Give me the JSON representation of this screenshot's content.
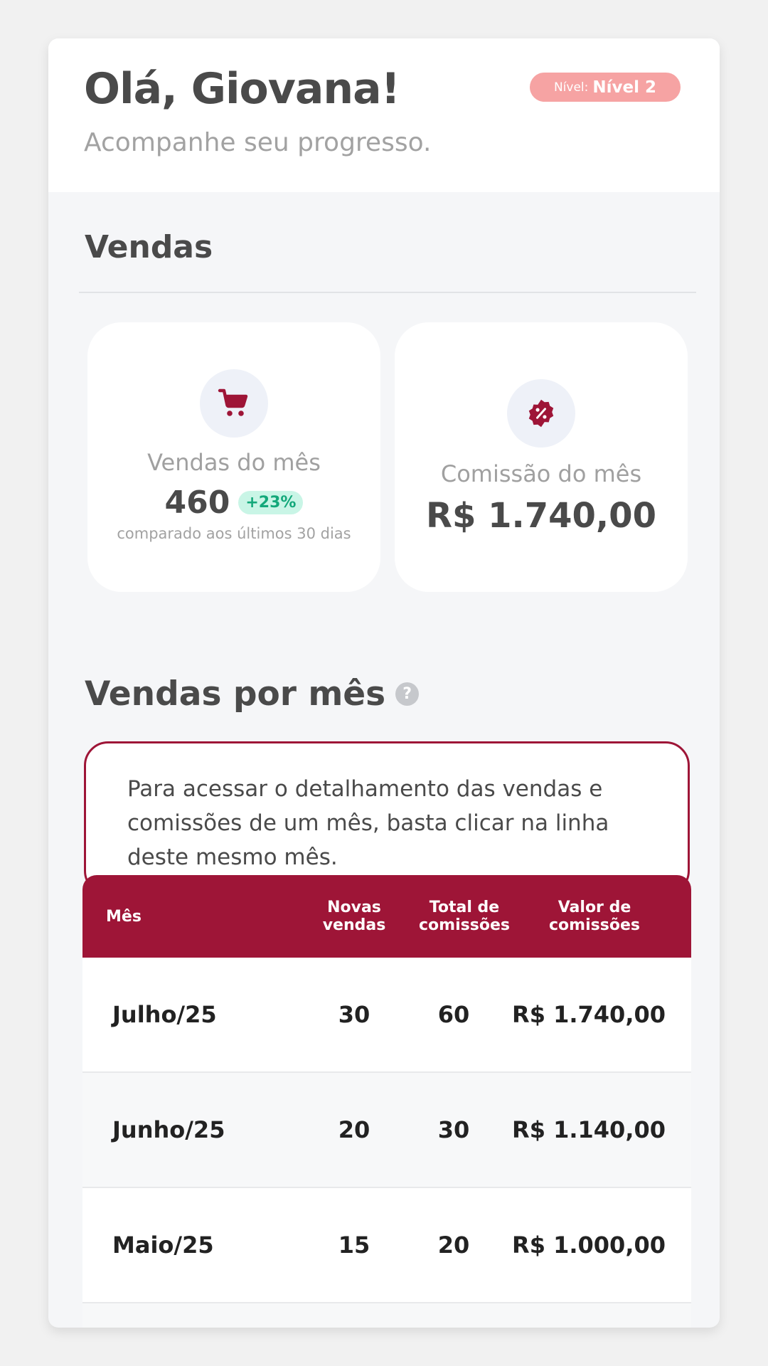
{
  "header": {
    "greeting": "Olá, Giovana!",
    "subtitle": "Acompanhe seu progresso.",
    "level_label": "Nível:",
    "level_value": "Nível 2"
  },
  "sales": {
    "title": "Vendas",
    "monthly_sales": {
      "icon": "cart-icon",
      "label": "Vendas do mês",
      "value": "460",
      "delta": "+23%",
      "note": "comparado aos últimos 30 dias"
    },
    "commission": {
      "icon": "discount-badge-icon",
      "label": "Comissão do mês",
      "value": "R$ 1.740,00"
    }
  },
  "monthly": {
    "title": "Vendas por mês",
    "help_icon": "?",
    "info": "Para acessar o detalhamento das vendas e comissões de um mês, basta clicar na linha deste mesmo mês."
  },
  "table": {
    "headers": [
      "Mês",
      "Novas vendas",
      "Total de comissões",
      "Valor de comissões"
    ],
    "rows": [
      [
        "Julho/25",
        "30",
        "60",
        "R$ 1.740,00"
      ],
      [
        "Junho/25",
        "20",
        "30",
        "R$ 1.140,00"
      ],
      [
        "Maio/25",
        "15",
        "20",
        "R$ 1.000,00"
      ]
    ]
  },
  "colors": {
    "brand": "#9e1537",
    "badge": "#f6a3a3",
    "positive": "#13a87a"
  }
}
